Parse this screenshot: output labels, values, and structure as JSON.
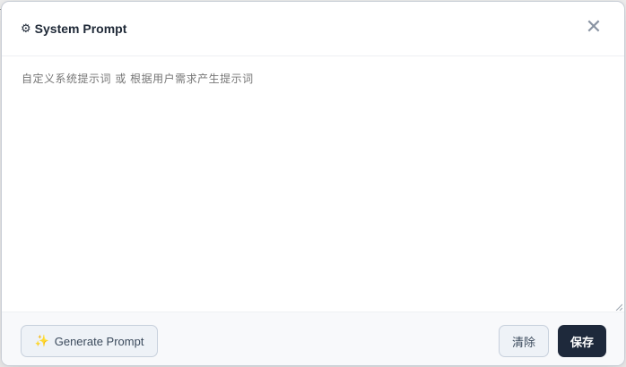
{
  "dialog": {
    "title": "System Prompt",
    "title_icon": "gear-icon",
    "close_icon": "close-icon",
    "close_glyph": "✕"
  },
  "prompt": {
    "value": "",
    "placeholder": "自定义系统提示词 或 根据用户需求产生提示词"
  },
  "footer": {
    "generate_label": "Generate Prompt",
    "generate_icon": "sparkle-icon",
    "clear_label": "清除",
    "save_label": "保存"
  },
  "colors": {
    "primary_dark": "#1e293b",
    "secondary_bg": "#eef2f7",
    "secondary_border": "#c7d0dc",
    "sparkle": "#e8a21a"
  }
}
